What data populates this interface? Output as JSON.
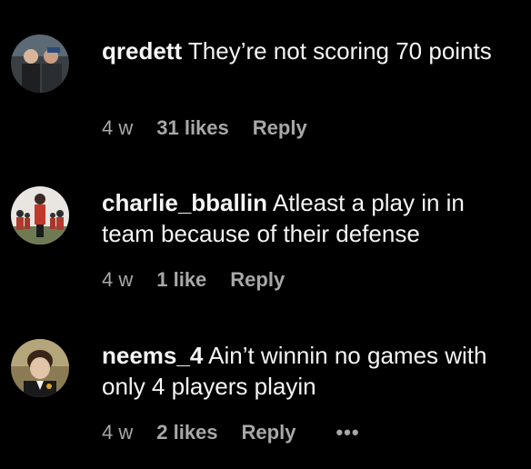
{
  "comments": [
    {
      "username": "qredett",
      "text": "They’re not scoring 70 points",
      "time": "4 w",
      "likes": "31 likes",
      "reply": "Reply",
      "avatar": "two-people-photo"
    },
    {
      "username": "charlie_bballin",
      "text": "Atleast a play in in team because of their defense",
      "time": "4 w",
      "likes": "1 like",
      "reply": "Reply",
      "avatar": "band-uniform-photo"
    },
    {
      "username": "neems_4",
      "text": "Ain’t winnin no games with only 4 players playin",
      "time": "4 w",
      "likes": "2 likes",
      "reply": "Reply",
      "more": "•••",
      "avatar": "child-portrait-photo"
    }
  ],
  "colors": {
    "background": "#000000",
    "text": "#f5f5f5",
    "meta": "#a8a8a8"
  }
}
